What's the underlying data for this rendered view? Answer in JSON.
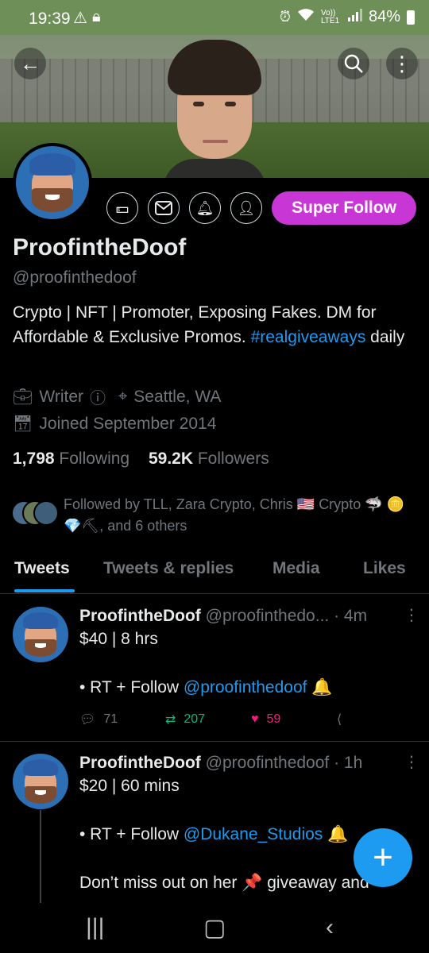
{
  "status_bar": {
    "time": "19:39",
    "left_icons": [
      "warning-icon",
      "lock-icon"
    ],
    "right_icons": [
      "alarm-icon",
      "wifi-icon",
      "volte-icon",
      "signal-icon"
    ],
    "volte_label": "Vo)) LTE1",
    "battery": "84%"
  },
  "profile": {
    "display_name": "ProofintheDoof",
    "handle": "@proofinthedoof",
    "bio_part1": "Crypto | NFT | Promoter, Exposing Fakes. DM for Affordable & Exclusive Promos. ",
    "bio_hashtag": "#realgiveaways",
    "bio_part2": " daily",
    "category": "Writer",
    "location": "Seattle, WA",
    "joined": "Joined September 2014",
    "following_count": "1,798",
    "following_label": "Following",
    "followers_count": "59.2K",
    "followers_label": "Followers",
    "followed_by": "Followed by TLL, Zara Crypto, Chris 🇺🇸 Crypto 🦈 🪙 💎⛏, and 6 others",
    "super_follow_label": "Super Follow",
    "action_icons": [
      "tip-icon",
      "message-icon",
      "notification-bell-icon",
      "following-icon"
    ]
  },
  "tabs": [
    "Tweets",
    "Tweets & replies",
    "Media",
    "Likes"
  ],
  "tweets": [
    {
      "name": "ProofintheDoof",
      "handle": "@proofinthedo...",
      "time": "· 4m",
      "line1": "$40 | 8 hrs",
      "line2_prefix": "• RT + Follow ",
      "line2_mention": "@proofinthedoof",
      "line2_suffix": " 🔔",
      "replies": "71",
      "retweets": "207",
      "likes": "59"
    },
    {
      "name": "ProofintheDoof",
      "handle": "@proofinthedoof",
      "time": "· 1h",
      "line1": "$20 | 60 mins",
      "line2_prefix": "• RT + Follow ",
      "line2_mention": "@Dukane_Studios",
      "line2_suffix": " 🔔",
      "line3": "Don’t miss out on her 📌 giveaway and"
    }
  ],
  "colors": {
    "accent": "#1d9bf0",
    "super_follow": "#c837d6",
    "retweet": "#00ba7c",
    "like": "#f91880",
    "muted": "#71767b"
  }
}
